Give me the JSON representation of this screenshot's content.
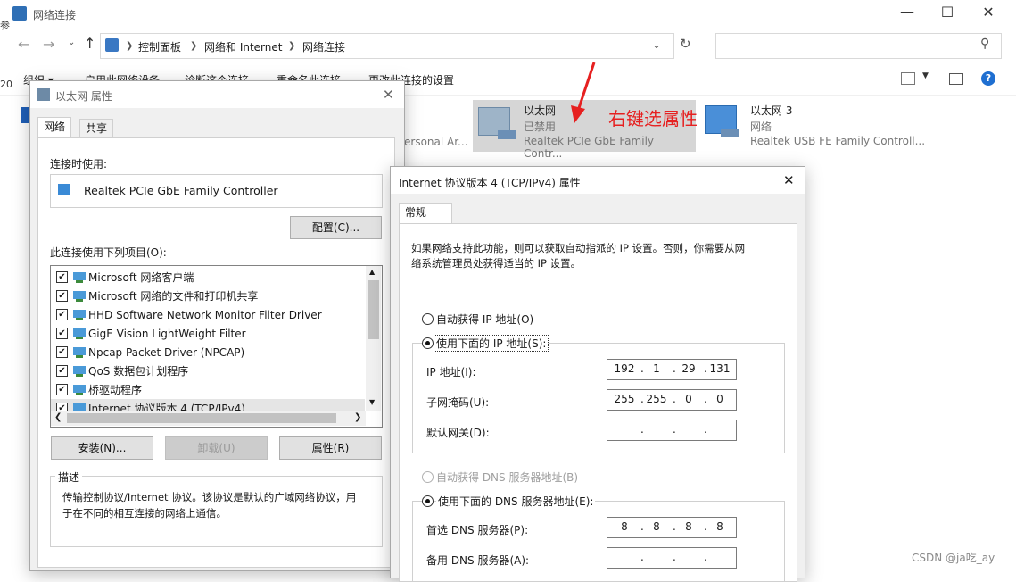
{
  "window": {
    "title": "网络连接",
    "breadcrumb": [
      "控制面板",
      "网络和 Internet",
      "网络连接"
    ],
    "search_placeholder": ""
  },
  "cmdbar": {
    "organize": "组织 ▾",
    "items": [
      "启用此网络设备",
      "诊断这个连接",
      "重命名此连接",
      "更改此连接的设置"
    ]
  },
  "adapters": [
    {
      "name": "ersonal Ar...",
      "status": "",
      "device": ""
    },
    {
      "name": "以太网",
      "status": "已禁用",
      "device": "Realtek PCIe GbE Family Contr..."
    },
    {
      "name": "以太网 3",
      "status": "网络",
      "device": "Realtek USB FE Family Controll..."
    }
  ],
  "annotation": "右键选属性",
  "props_dialog": {
    "title": "以太网 属性",
    "tabs": [
      "网络",
      "共享"
    ],
    "connect_using_label": "连接时使用:",
    "adapter": "Realtek PCIe GbE Family Controller",
    "configure_btn": "配置(C)...",
    "items_label": "此连接使用下列项目(O):",
    "items": [
      {
        "label": "Microsoft 网络客户端",
        "checked": true
      },
      {
        "label": "Microsoft 网络的文件和打印机共享",
        "checked": true
      },
      {
        "label": "HHD Software Network Monitor Filter Driver",
        "checked": true
      },
      {
        "label": "GigE Vision LightWeight Filter",
        "checked": true
      },
      {
        "label": "Npcap Packet Driver (NPCAP)",
        "checked": true
      },
      {
        "label": "QoS 数据包计划程序",
        "checked": true
      },
      {
        "label": "桥驱动程序",
        "checked": true
      },
      {
        "label": "Internet 协议版本 4 (TCP/IPv4)",
        "checked": true
      }
    ],
    "install_btn": "安装(N)...",
    "uninstall_btn": "卸载(U)",
    "properties_btn": "属性(R)",
    "desc_label": "描述",
    "desc_text_1": "传输控制协议/Internet 协议。该协议是默认的广域网络协议，用",
    "desc_text_2": "于在不同的相互连接的网络上通信。"
  },
  "ipv4_dialog": {
    "title": "Internet 协议版本 4 (TCP/IPv4) 属性",
    "tab": "常规",
    "intro_1": "如果网络支持此功能，则可以获取自动指派的 IP 设置。否则，你需要从网",
    "intro_2": "络系统管理员处获得适当的 IP 设置。",
    "auto_ip": "自动获得 IP 地址(O)",
    "manual_ip": "使用下面的 IP 地址(S):",
    "ip_label": "IP 地址(I):",
    "ip": [
      "192",
      "1",
      "29",
      "131"
    ],
    "mask_label": "子网掩码(U):",
    "mask": [
      "255",
      "255",
      "0",
      "0"
    ],
    "gw_label": "默认网关(D):",
    "gw": [
      "",
      "",
      "",
      ""
    ],
    "auto_dns": "自动获得 DNS 服务器地址(B)",
    "manual_dns": "使用下面的 DNS 服务器地址(E):",
    "dns1_label": "首选 DNS 服务器(P):",
    "dns1": [
      "8",
      "8",
      "8",
      "8"
    ],
    "dns2_label": "备用 DNS 服务器(A):",
    "dns2": [
      "",
      "",
      "",
      ""
    ]
  },
  "watermark": "CSDN @ja吃_ay"
}
